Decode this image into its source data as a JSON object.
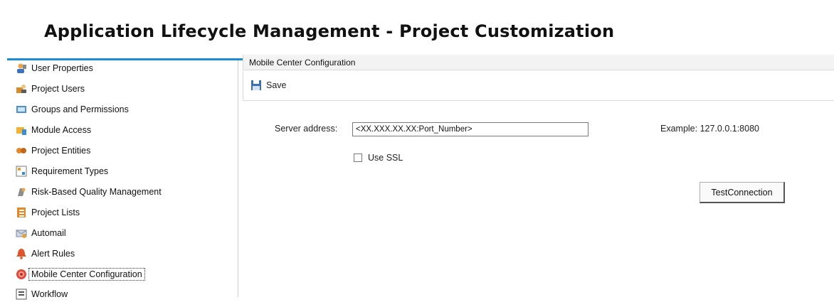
{
  "header": {
    "title": "Application Lifecycle Management - Project Customization"
  },
  "sidebar": {
    "items": [
      {
        "label": "User Properties",
        "icon": "user-properties-icon"
      },
      {
        "label": "Project Users",
        "icon": "project-users-icon"
      },
      {
        "label": "Groups and Permissions",
        "icon": "groups-icon"
      },
      {
        "label": "Module Access",
        "icon": "module-access-icon"
      },
      {
        "label": "Project Entities",
        "icon": "project-entities-icon"
      },
      {
        "label": "Requirement Types",
        "icon": "requirement-types-icon"
      },
      {
        "label": "Risk-Based Quality Management",
        "icon": "risk-icon"
      },
      {
        "label": "Project Lists",
        "icon": "project-lists-icon"
      },
      {
        "label": "Automail",
        "icon": "automail-icon"
      },
      {
        "label": "Alert Rules",
        "icon": "alert-rules-icon"
      },
      {
        "label": "Mobile Center Configuration",
        "icon": "mobile-center-icon",
        "selected": true
      },
      {
        "label": "Workflow",
        "icon": "workflow-icon"
      }
    ]
  },
  "main": {
    "section_title": "Mobile Center Configuration",
    "toolbar": {
      "save_label": "Save"
    },
    "form": {
      "server_address_label": "Server address:",
      "server_address_value": "<XX.XXX.XX.XX:Port_Number>",
      "example_text": "Example: 127.0.0.1:8080",
      "use_ssl_label": "Use SSL",
      "use_ssl_checked": false,
      "test_connection_label": "TestConnection"
    }
  }
}
